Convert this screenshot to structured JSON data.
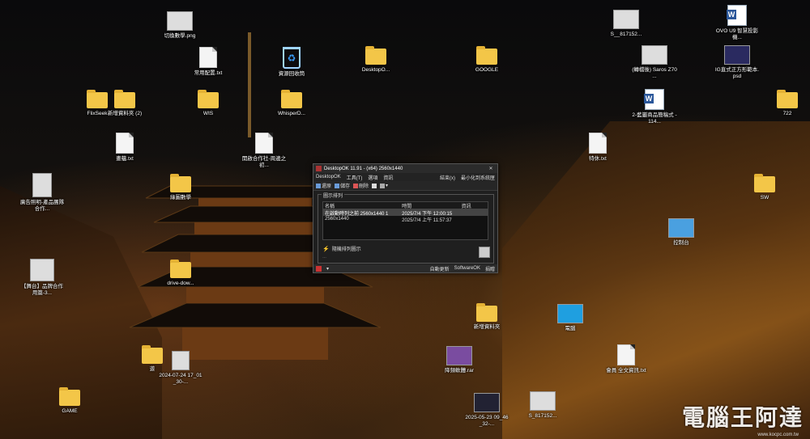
{
  "desktop": {
    "icons": [
      {
        "id": "i1",
        "label": "切換數學.png",
        "type": "image"
      },
      {
        "id": "i2",
        "label": "常用配置.txt",
        "type": "doc"
      },
      {
        "id": "i3",
        "label": "資源回收筒",
        "type": "bin"
      },
      {
        "id": "i4",
        "label": "DesktopO...",
        "type": "folder"
      },
      {
        "id": "i5",
        "label": "GOOGLE",
        "type": "folder"
      },
      {
        "id": "i6",
        "label": "S__817152...",
        "type": "image"
      },
      {
        "id": "i7",
        "label": "OVO U9 智慧投影機...",
        "type": "word"
      },
      {
        "id": "i8",
        "label": "FlixSeek",
        "type": "folder"
      },
      {
        "id": "i9",
        "label": "新增資料夾 (2)",
        "type": "folder"
      },
      {
        "id": "i10",
        "label": "WIS",
        "type": "folder"
      },
      {
        "id": "i11",
        "label": "WhisperD...",
        "type": "folder"
      },
      {
        "id": "i12",
        "label": "(轉檔後) Saros Z70 ...",
        "type": "image"
      },
      {
        "id": "i13",
        "label": "IG直式正方形範本.psd",
        "type": "image"
      },
      {
        "id": "i14",
        "label": "722",
        "type": "folder"
      },
      {
        "id": "i15",
        "label": "2-藍巖商品簡稿式 - 114...",
        "type": "word"
      },
      {
        "id": "i16",
        "label": "畫蘊.txt",
        "type": "doc"
      },
      {
        "id": "i17",
        "label": "開啟合作社-周邊之初...",
        "type": "doc"
      },
      {
        "id": "i18",
        "label": "特休.txt",
        "type": "doc"
      },
      {
        "id": "i19",
        "label": "廣告照明-產品團隊合作...",
        "type": "image"
      },
      {
        "id": "i20",
        "label": "綠圖數學",
        "type": "folder"
      },
      {
        "id": "i21",
        "label": "SW",
        "type": "folder"
      },
      {
        "id": "i22",
        "label": "控制台",
        "type": "image"
      },
      {
        "id": "i23",
        "label": "【舞台】品牌合作用篇-3...",
        "type": "image"
      },
      {
        "id": "i24",
        "label": "drive-dow...",
        "type": "folder"
      },
      {
        "id": "i25",
        "label": "新增資料夾",
        "type": "folder"
      },
      {
        "id": "i26",
        "label": "電腦",
        "type": "image"
      },
      {
        "id": "i27",
        "label": "遊",
        "type": "folder"
      },
      {
        "id": "i28",
        "label": "2024-07-24 17_01_30-...",
        "type": "image"
      },
      {
        "id": "i29",
        "label": "降頻軟體.rar",
        "type": "image"
      },
      {
        "id": "i30",
        "label": "會員 全文資訊.txt",
        "type": "doc"
      },
      {
        "id": "i31",
        "label": "GAME",
        "type": "folder"
      },
      {
        "id": "i32",
        "label": "2025-05-23 09_46_32-...",
        "type": "image"
      },
      {
        "id": "i33",
        "label": "S_817152...",
        "type": "image"
      }
    ]
  },
  "window": {
    "title": "DesktopOK 11.91 - (x64) 2560x1440",
    "close": "✕",
    "menu": [
      "DesktopOK",
      "工具(T)",
      "選項",
      "資訊"
    ],
    "menu_right": [
      "結束(x)",
      "最小化到系統匣"
    ],
    "toolbar": [
      "還原",
      "儲存",
      "刪除"
    ],
    "group_title": "圖示排列",
    "columns": [
      "名稱",
      "時間",
      "資訊"
    ],
    "rows": [
      {
        "name": "在啟動時列之前 2560x1440 1",
        "time": "2025/7/4 下午 12:00:15",
        "info": ""
      },
      {
        "name": "2560x1440",
        "time": "2025/7/4 上午 11:57:37",
        "info": ""
      }
    ],
    "auto_arrange": "隨機排列圖示",
    "status_right": [
      "自動更新",
      "SoftwareOK",
      "捐贈"
    ]
  },
  "watermark": {
    "text": "電腦王阿達",
    "sub": "www.kocpc.com.tw"
  }
}
